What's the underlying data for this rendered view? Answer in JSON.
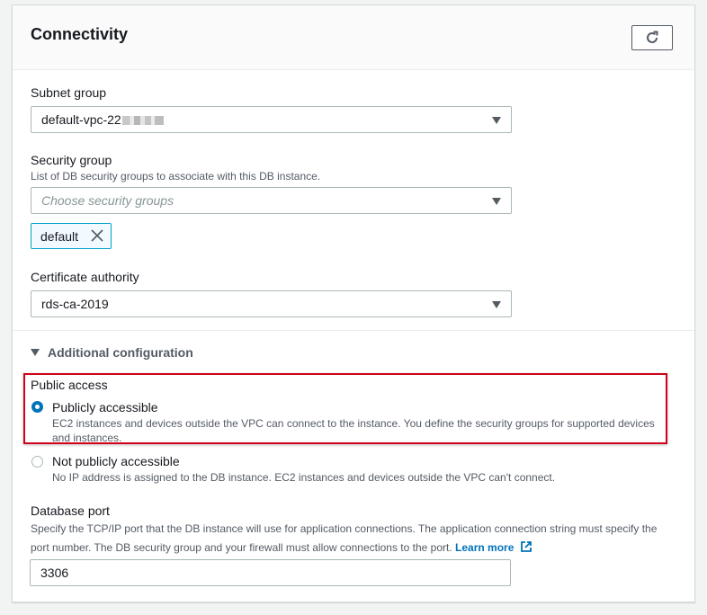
{
  "connectivity": {
    "title": "Connectivity",
    "refresh_icon": "refresh-icon",
    "subnet_group": {
      "label": "Subnet group",
      "value": "default-vpc-22"
    },
    "security_group": {
      "label": "Security group",
      "description": "List of DB security groups to associate with this DB instance.",
      "placeholder": "Choose security groups",
      "tokens": [
        "default"
      ]
    },
    "certificate_authority": {
      "label": "Certificate authority",
      "value": "rds-ca-2019"
    },
    "additional_configuration": {
      "label": "Additional configuration",
      "expanded": true
    },
    "public_access": {
      "label": "Public access",
      "options": [
        {
          "label": "Publicly accessible",
          "description": "EC2 instances and devices outside the VPC can connect to the instance. You define the security groups for supported devices and instances.",
          "selected": true
        },
        {
          "label": "Not publicly accessible",
          "description": "No IP address is assigned to the DB instance. EC2 instances and devices outside the VPC can't connect.",
          "selected": false
        }
      ]
    },
    "database_port": {
      "label": "Database port",
      "description": "Specify the TCP/IP port that the DB instance will use for application connections. The application connection string must specify the port number. The DB security group and your firewall must allow connections to the port.",
      "learn_more": "Learn more",
      "value": "3306"
    }
  },
  "colors": {
    "accent": "#0073bb",
    "highlight_border": "#d0021b",
    "token_border": "#00a1c9"
  }
}
